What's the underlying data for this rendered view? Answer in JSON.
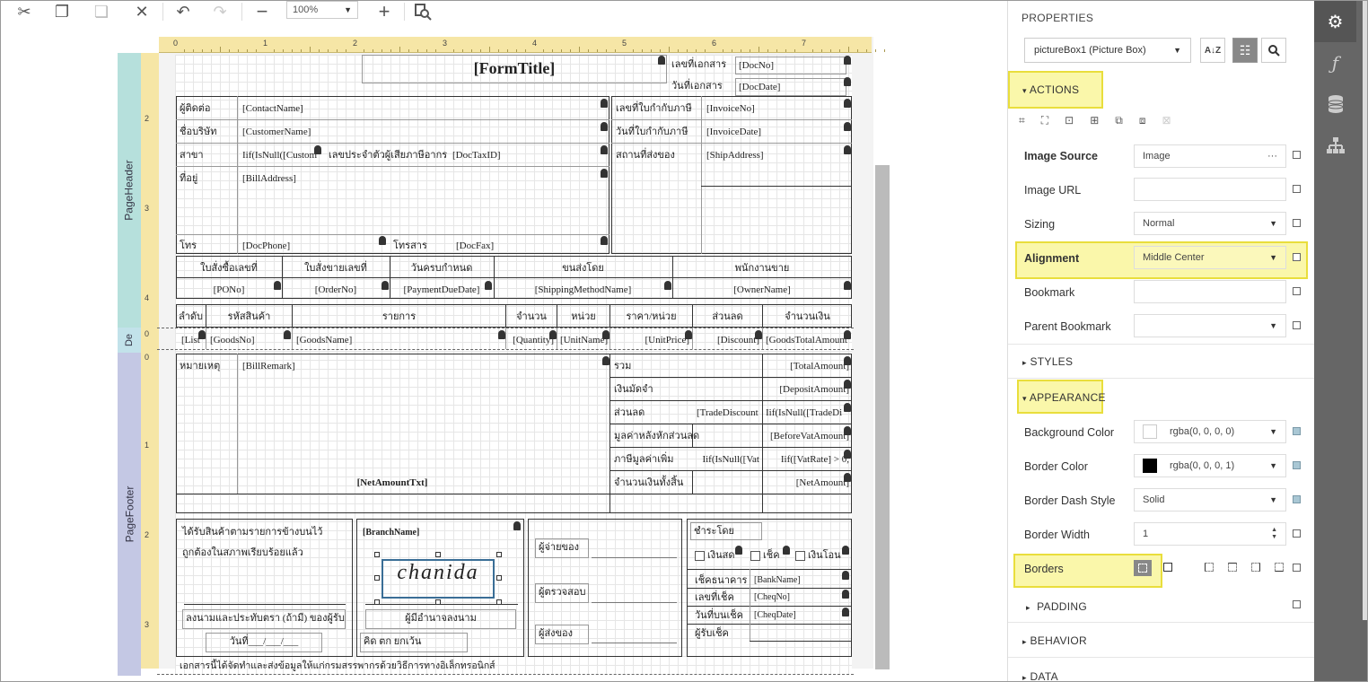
{
  "toolbar": {
    "zoom": "100%"
  },
  "ruler": {
    "h_ticks": [
      "0",
      "1",
      "2",
      "3",
      "4",
      "5",
      "6",
      "7"
    ],
    "v_ticks": [
      "2",
      "3",
      "4",
      "0",
      "0",
      "1",
      "2",
      "3"
    ]
  },
  "bands": {
    "header": "PageHeader",
    "detail": "De",
    "footer": "PageFooter"
  },
  "report": {
    "title": "[FormTitle]",
    "doc_no_label": "เลขที่เอกสาร",
    "doc_no": "[DocNo]",
    "doc_date_label": "วันที่เอกสาร",
    "doc_date": "[DocDate]",
    "contact_label": "ผู้ติดต่อ",
    "contact": "[ContactName]",
    "invoice_no_label": "เลขที่ใบกำกับภาษี",
    "invoice_no": "[InvoiceNo]",
    "company_label": "ชื่อบริษัท",
    "customer": "[CustomerName]",
    "invoice_date_label": "วันที่ใบกำกับภาษี",
    "invoice_date": "[InvoiceDate]",
    "branch_label": "สาขา",
    "branch_expr": "Iif(IsNull([Custom",
    "taxid_label": "เลขประจำตัวผู้เสียภาษีอากร",
    "taxid": "[DocTaxID]",
    "ship_label": "สถานที่ส่งของ",
    "ship": "[ShipAddress]",
    "address_label": "ที่อยู่",
    "address": "[BillAddress]",
    "phone_label": "โทร",
    "phone": "[DocPhone]",
    "fax_label": "โทรสาร",
    "fax": "[DocFax]",
    "order_headers": [
      "ใบสั่งซื้อเลขที่",
      "ใบสั่งขายเลขที่",
      "วันครบกำหนด",
      "ขนส่งโดย",
      "พนักงานขาย"
    ],
    "order_values": [
      "[PONo]",
      "[OrderNo]",
      "[PaymentDueDate]",
      "[ShippingMethodName]",
      "[OwnerName]"
    ],
    "item_headers": [
      "ลำดับ",
      "รหัสสินค้า",
      "รายการ",
      "จำนวน",
      "หน่วย",
      "ราคา/หน่วย",
      "ส่วนลด",
      "จำนวนเงิน"
    ],
    "item_values": [
      "[List",
      "[GoodsNo]",
      "[GoodsName]",
      "[Quantity]",
      "[UnitName]",
      "[UnitPrice]",
      "[Discount]",
      "[GoodsTotalAmount"
    ],
    "remark_label": "หมายเหตุ",
    "remark": "[BillRemark]",
    "summary_labels": [
      "รวม",
      "เงินมัดจำ",
      "ส่วนลด",
      "มูลค่าหลังหักส่วนลด",
      "ภาษีมูลค่าเพิ่ม",
      "จำนวนเงินทั้งสิ้น"
    ],
    "summary_values": [
      "[TotalAmount]",
      "[DepositAmount]",
      "Iif(IsNull([TradeDi",
      "[BeforeVatAmount]",
      "Iif([VatRate] > 0,",
      "[NetAmount]"
    ],
    "trade_discount": "[TradeDiscount",
    "vat_expr": "Iif(IsNull([Vat",
    "net_txt": "[NetAmountTxt]",
    "received_1": "ได้รับสินค้าตามรายการข้างบนไว้",
    "received_2": "ถูกต้องในสภาพเรียบร้อยแล้ว",
    "sign_receiver": "ลงนามและประทับตรา (ถ้ามี) ของผู้รับ",
    "date_line": "วันที่___/___/___",
    "branch_name": "[BranchName]",
    "signature": "chanida",
    "authorized": "ผู้มีอำนาจลงนาม",
    "baht_text": "คิด ตก ยกเว้น",
    "payer": "ผู้จ่ายของ",
    "checker": "ผู้ตรวจสอบ",
    "sender": "ผู้ส่งของ",
    "pay_by": "ชำระโดย",
    "cash": "เงินสด",
    "cheque": "เช็ค",
    "transfer": "เงินโอน",
    "bank_label": "เช็คธนาคาร",
    "bank": "[BankName]",
    "cheq_no_label": "เลขที่เช็ค",
    "cheq_no": "[CheqNo]",
    "cheq_date_label": "วันที่บนเช็ค",
    "cheq_date": "[CheqDate]",
    "cheq_receiver": "ผู้รับเช็ค",
    "footer_note": "เอกสารนี้ได้จัดทำและส่งข้อมูลให้แก่กรมสรรพากรด้วยวิธีการทางอิเล็กทรอนิกส์"
  },
  "props": {
    "header": "PROPERTIES",
    "component": "pictureBox1 (Picture Box)",
    "actions": "ACTIONS",
    "image_source_label": "Image Source",
    "image_source": "Image",
    "ellipsis": "···",
    "image_url_label": "Image URL",
    "sizing_label": "Sizing",
    "sizing": "Normal",
    "alignment_label": "Alignment",
    "alignment": "Middle Center",
    "bookmark_label": "Bookmark",
    "parent_bookmark_label": "Parent Bookmark",
    "styles": "STYLES",
    "appearance": "APPEARANCE",
    "bg_color_label": "Background Color",
    "bg_color": "rgba(0, 0, 0, 0)",
    "border_color_label": "Border Color",
    "border_color": "rgba(0, 0, 0, 1)",
    "border_dash_label": "Border Dash Style",
    "border_dash": "Solid",
    "border_width_label": "Border Width",
    "border_width": "1",
    "borders_label": "Borders",
    "padding": "PADDING",
    "behavior": "BEHAVIOR",
    "data": "DATA"
  },
  "colors": {
    "highlight": "#f5f064",
    "header_band": "#b6e0dc",
    "footer_band": "#c4c8e4",
    "ruler": "#f6e6a6"
  }
}
